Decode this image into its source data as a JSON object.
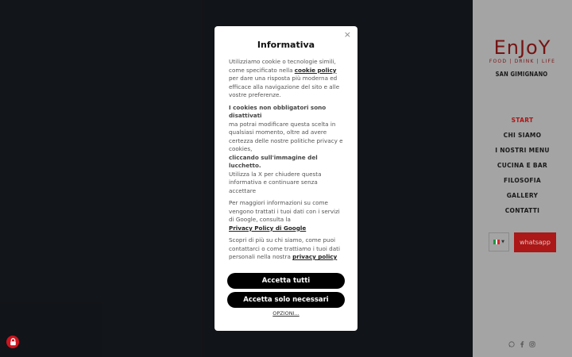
{
  "sidebar": {
    "logo_main": "EnJoY",
    "logo_sub": "FOOD | DRINK | LIFE",
    "location": "SAN GIMIGNANO",
    "nav": [
      {
        "label": "START",
        "active": true
      },
      {
        "label": "CHI SIAMO",
        "active": false
      },
      {
        "label": "I NOSTRI MENU",
        "active": false
      },
      {
        "label": "CUCINA E BAR",
        "active": false
      },
      {
        "label": "FILOSOFIA",
        "active": false
      },
      {
        "label": "GALLERY",
        "active": false
      },
      {
        "label": "CONTATTI",
        "active": false
      }
    ],
    "language": {
      "flag": "italy-flag",
      "colors": [
        "#1f9a46",
        "#ffffff",
        "#d52b2b"
      ]
    },
    "whatsapp_label": "whatsapp",
    "social_icons": [
      "whatsapp-icon",
      "facebook-icon",
      "instagram-icon"
    ]
  },
  "modal": {
    "title": "Informativa",
    "close_symbol": "×",
    "p1_text": "Utilizziamo cookie o tecnologie simili, come specificato nella ",
    "p1_link": "cookie policy",
    "p1_rest": " per dare una risposta più moderna ed efficace alla navigazione del sito e alle vostre preferenze.",
    "p2_bold": "I cookies non obbligatori sono disattivati",
    "p2_text": "ma potrai modificare questa scelta in qualsiasi momento, oltre ad avere certezza delle nostre politiche privacy e cookies,",
    "p2_bold2": "cliccando sull'immagine del lucchetto.",
    "p2_text2": "Utilizza la X per chiudere questa informativa e continuare senza accettare",
    "p3_text": "Per maggiori informazioni su come vengono trattati i tuoi dati con i servizi di Google, consulta la",
    "p3_link": "Privacy Policy di Google",
    "p4_text": "Scopri di più su chi siamo, come puoi contattarci o come trattiamo i tuoi dati personali nella nostra ",
    "p4_link": "privacy policy",
    "accept_all": "Accetta tutti",
    "accept_necessary": "Accetta solo necessari",
    "options": "OPZIONI..."
  },
  "colors": {
    "accent_red": "#b01818",
    "sidebar_bg": "#a8a8a8",
    "page_bg": "#121519",
    "lock_red": "#d4141f"
  }
}
